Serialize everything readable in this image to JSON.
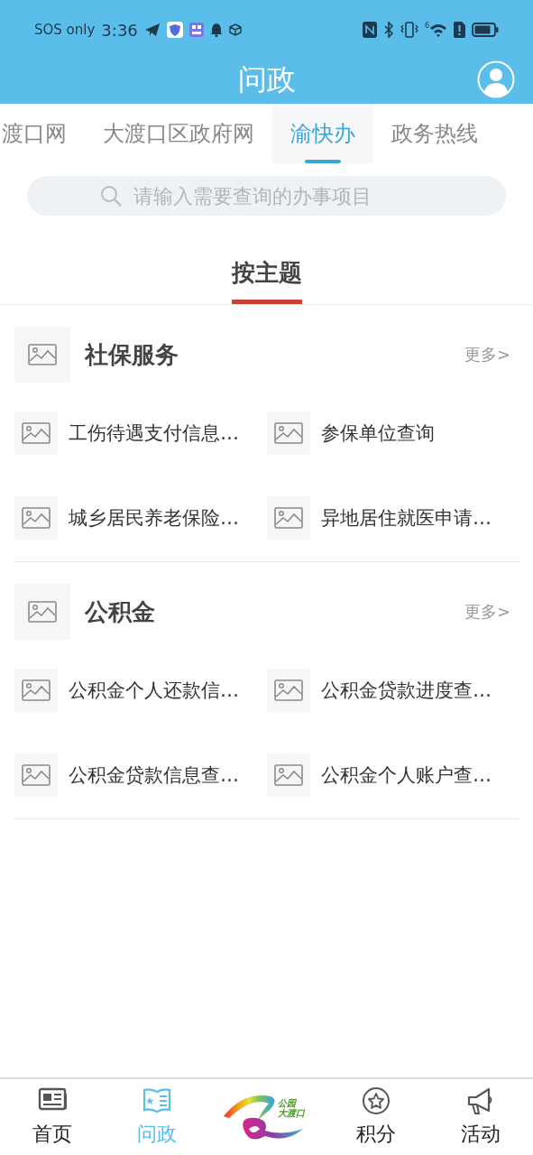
{
  "status_bar": {
    "carrier": "SOS only",
    "time": "3:36",
    "wifi_badge": "6"
  },
  "header": {
    "title": "问政"
  },
  "tabs": [
    {
      "label": "渡口网",
      "selected": false
    },
    {
      "label": "大渡口区政府网",
      "selected": false
    },
    {
      "label": "渝快办",
      "selected": true
    },
    {
      "label": "政务热线",
      "selected": false
    }
  ],
  "search": {
    "placeholder": "请输入需要查询的办事项目"
  },
  "topic_tab": {
    "label": "按主题",
    "selected": true
  },
  "sections": [
    {
      "title": "社保服务",
      "more": "更多>",
      "items": [
        "工伤待遇支付信息…",
        "参保单位查询",
        "城乡居民养老保险…",
        "异地居住就医申请…"
      ]
    },
    {
      "title": "公积金",
      "more": "更多>",
      "items": [
        "公积金个人还款信…",
        "公积金贷款进度查…",
        "公积金贷款信息查…",
        "公积金个人账户查…"
      ]
    }
  ],
  "bottom_nav": [
    {
      "kind": "tab",
      "label": "首页",
      "selected": false
    },
    {
      "kind": "tab",
      "label": "问政",
      "selected": true
    },
    {
      "kind": "logo",
      "lines": [
        "公园",
        "大渡口"
      ]
    },
    {
      "kind": "tab",
      "label": "积分",
      "selected": false
    },
    {
      "kind": "tab",
      "label": "活动",
      "selected": false
    }
  ]
}
